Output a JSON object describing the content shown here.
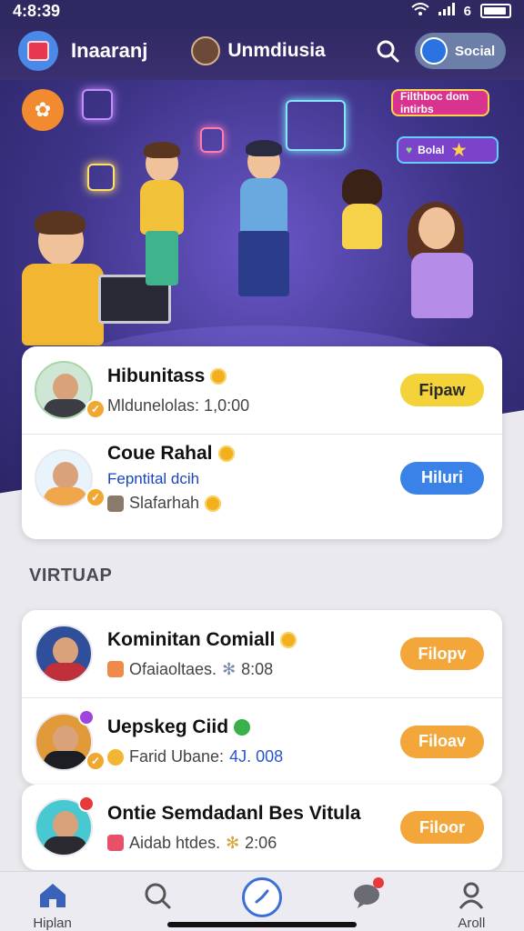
{
  "status_bar": {
    "time": "4:8:39",
    "battery": "6"
  },
  "header": {
    "app_title": "Inaaranj",
    "profile_name": "Unmdiusia",
    "social_label": "Social"
  },
  "hero": {
    "sticker_top": "Filthboc dom intirbs",
    "sticker_social": "Bolal"
  },
  "featured": [
    {
      "name": "Hibunitass",
      "sub": "Mldunelolas: 1,0:00",
      "button": "Fipaw",
      "button_color": "#f3d23a",
      "button_text_color": "#2b2b2b"
    },
    {
      "name": "Coue Rahal",
      "sub_line": "Fepntital dcih",
      "sub": "Slafarhah",
      "button": "Hiluri",
      "button_color": "#3b82e8",
      "button_text_color": "#ffffff"
    }
  ],
  "section_title": "VIRTUAP",
  "virtual": [
    {
      "name": "Kominitan Comiall",
      "sub": "Ofaiaoltaes.",
      "meta": "8:08",
      "button": "Filopv",
      "button_color": "#f3a63a"
    },
    {
      "name": "Uepskeg Ciid",
      "sub": "Farid Ubane:",
      "meta": "4J. 008",
      "button": "Filoav",
      "button_color": "#f3a63a"
    },
    {
      "name": "Ontie Semdadanl Bes Vitula",
      "sub": "Aidab htdes.",
      "meta": "2:06",
      "button": "Filoor",
      "button_color": "#f3a63a"
    }
  ],
  "bottom_nav": [
    {
      "label": "Hiplan",
      "icon": "home-icon"
    },
    {
      "label": "",
      "icon": "search-icon"
    },
    {
      "label": "",
      "icon": "compass-icon"
    },
    {
      "label": "",
      "icon": "chat-bubble-icon"
    },
    {
      "label": "Aroll",
      "icon": "profile-icon"
    }
  ]
}
